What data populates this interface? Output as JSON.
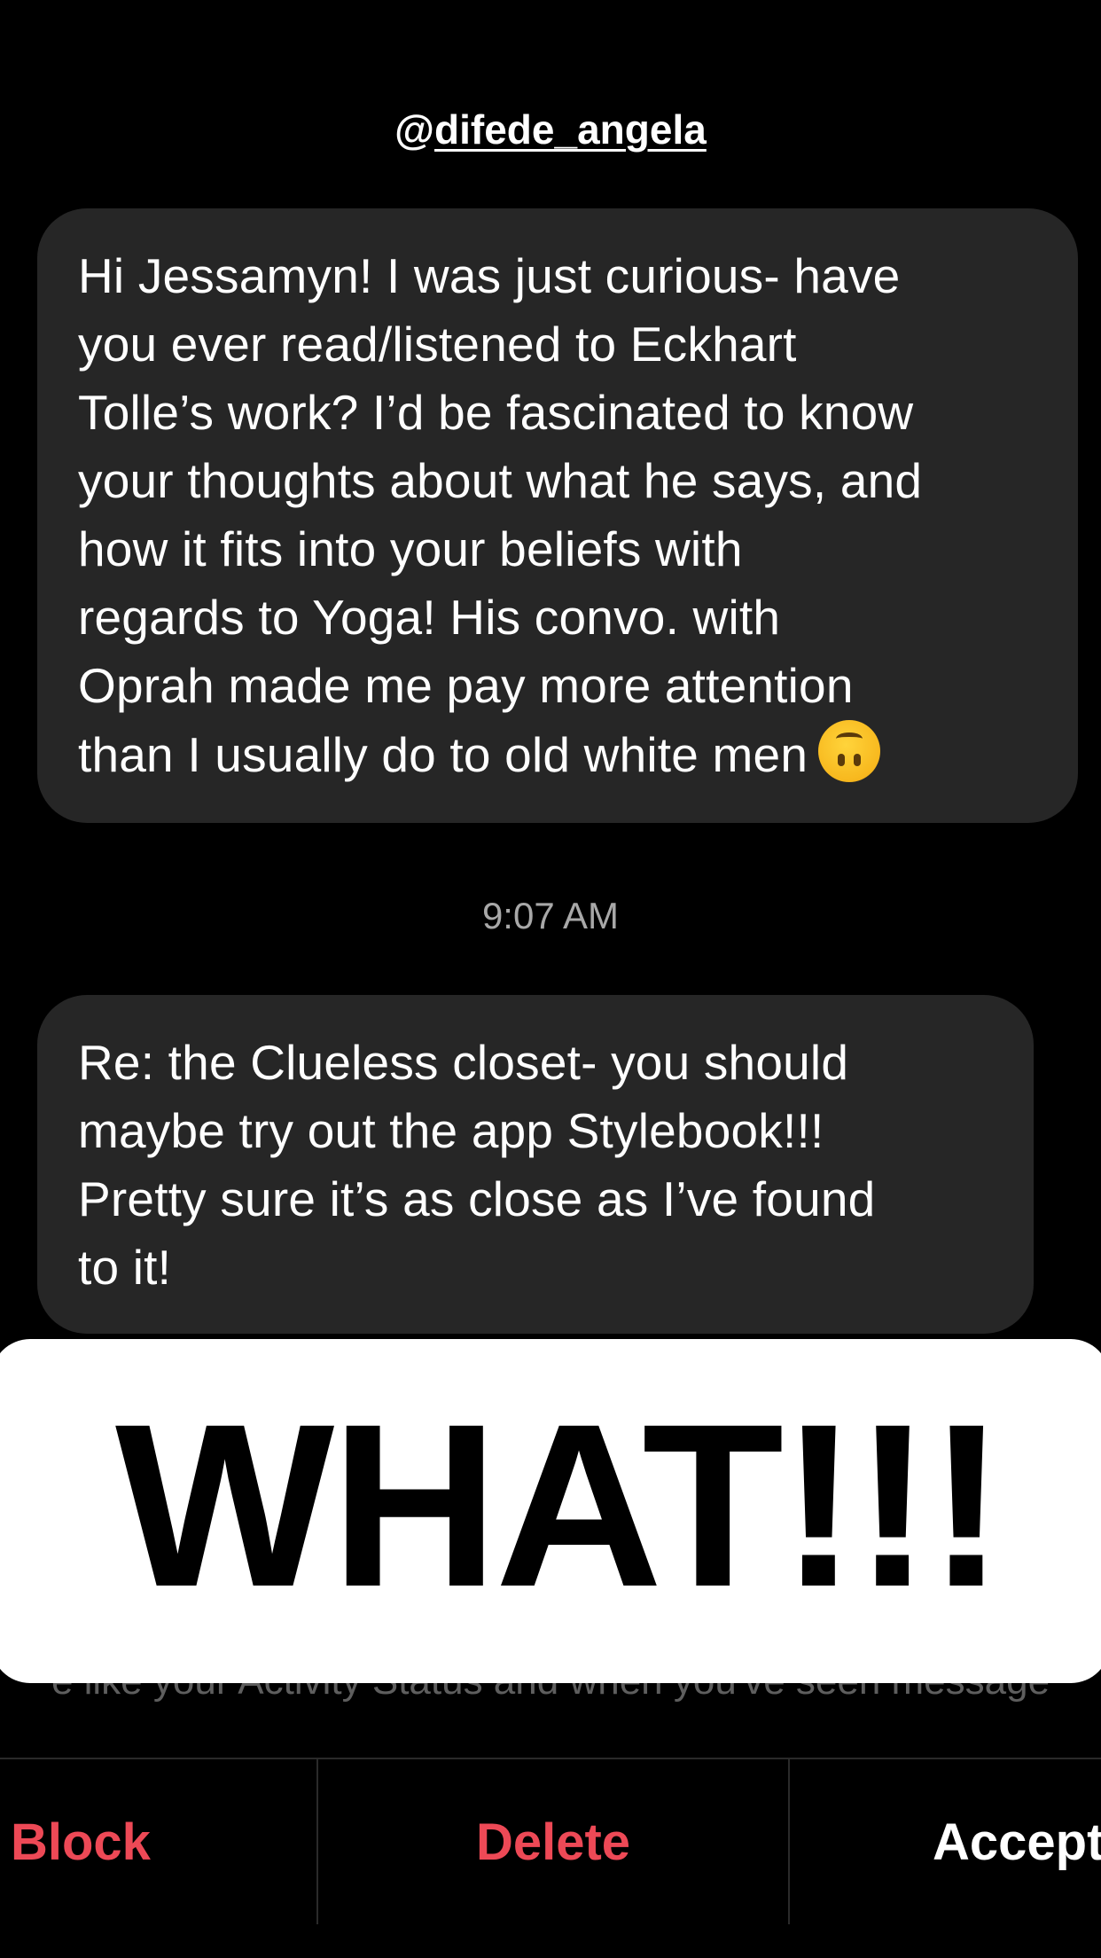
{
  "header": {
    "handle_prefix": "@",
    "handle_name": "difede_angela"
  },
  "messages": [
    {
      "lines": [
        "Hi Jessamyn! I was just curious- have",
        "you ever read/listened to Eckhart",
        "Tolle’s work? I’d be fascinated to know",
        "your thoughts about what he says, and",
        "how it fits into your beliefs with",
        "regards to Yoga! His convo. with",
        "Oprah made me pay more attention",
        "than I usually do to old white men"
      ],
      "emoji": "upside-down-face-emoji"
    },
    {
      "lines": [
        "Re: the Clueless closet- you should",
        "maybe try out the app Stylebook!!!",
        "Pretty sure it’s as close as I’ve found",
        "to it!"
      ]
    }
  ],
  "timestamp": "9:07 AM",
  "info_text": "e like your Activity Status and when you've seen message",
  "sticker": {
    "text": "WHAT!!!"
  },
  "actions": {
    "block_label": "Block",
    "delete_label": "Delete",
    "accept_label": "Accept"
  },
  "colors": {
    "background": "#000000",
    "bubble": "#262626",
    "destructive": "#ed4956",
    "timestamp": "#a8a8a8"
  }
}
